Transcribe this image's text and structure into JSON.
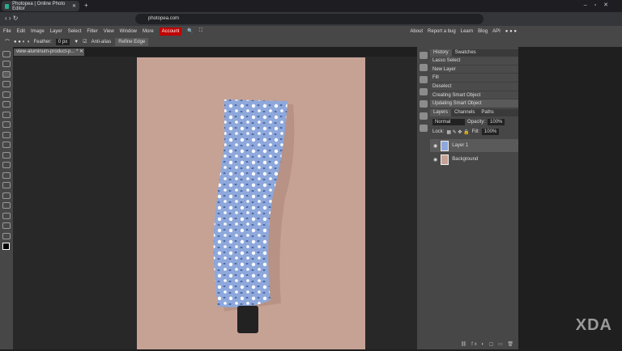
{
  "browser": {
    "tab_title": "Photopea | Online Photo Editor",
    "url": "photopea.com"
  },
  "menu": {
    "items": [
      "File",
      "Edit",
      "Image",
      "Layer",
      "Select",
      "Filter",
      "View",
      "Window",
      "More"
    ],
    "account": "Account",
    "links": [
      "About",
      "Report a bug",
      "Learn",
      "Blog",
      "API"
    ]
  },
  "options": {
    "feather_label": "Feather:",
    "feather_value": "0 px",
    "antialias": "Anti-alias",
    "refine": "Refine Edge"
  },
  "document": {
    "tab": "view-aluminum-product-p... *"
  },
  "history": {
    "tabs": [
      "History",
      "Swatches"
    ],
    "items": [
      "Lasso Select",
      "New Layer",
      "Fill",
      "Deselect",
      "Creating Smart Object",
      "Updating Smart Object"
    ]
  },
  "layers": {
    "tabs": [
      "Layers",
      "Channels",
      "Paths"
    ],
    "blend": "Normal",
    "opacity_label": "Opacity:",
    "opacity": "100%",
    "lock_label": "Lock:",
    "fill_label": "Fill:",
    "fill": "100%",
    "items": [
      "Layer 1",
      "Background"
    ]
  },
  "watermark": "XDA"
}
